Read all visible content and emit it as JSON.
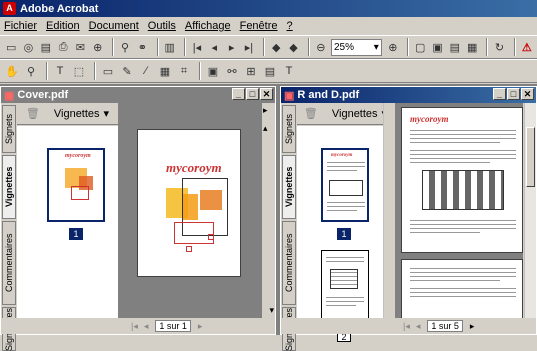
{
  "app": {
    "title": "Adobe Acrobat"
  },
  "menu": [
    "Fichier",
    "Edition",
    "Document",
    "Outils",
    "Affichage",
    "Fenêtre",
    "?"
  ],
  "toolbar": {
    "zoom": "25%"
  },
  "windows": [
    {
      "title": "Cover.pdf",
      "panel_label": "Vignettes",
      "status_page": "1 sur 1",
      "thumbs": [
        "1"
      ]
    },
    {
      "title": "R and D.pdf",
      "panel_label": "Vignettes",
      "status_page": "1 sur 5",
      "thumbs": [
        "1",
        "2"
      ]
    }
  ],
  "side_tabs": [
    "Signets",
    "Vignettes",
    "Commentaires",
    "Signatures"
  ],
  "doc_art": "mycoroym"
}
